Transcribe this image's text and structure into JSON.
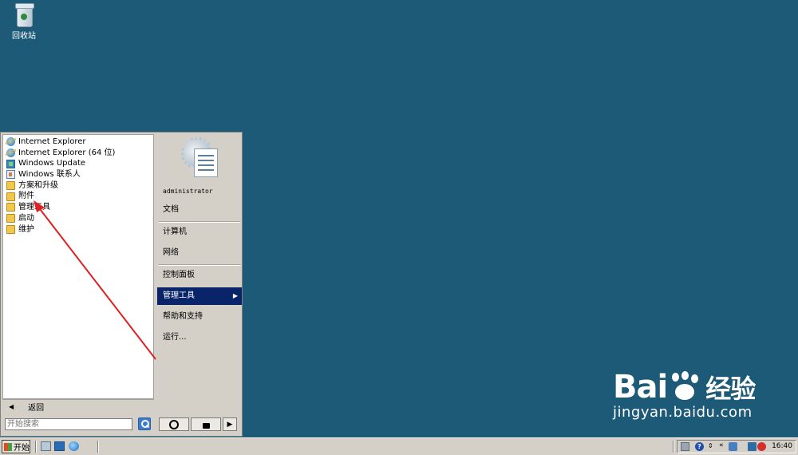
{
  "desktop": {
    "recycle_bin_label": "回收站"
  },
  "start_menu": {
    "programs": [
      {
        "label": "Internet Explorer",
        "icon": "ie-icon"
      },
      {
        "label": "Internet Explorer (64 位)",
        "icon": "ie-icon"
      },
      {
        "label": "Windows Update",
        "icon": "windows-update-icon"
      },
      {
        "label": "Windows 联系人",
        "icon": "contacts-icon"
      },
      {
        "label": "方案和升级",
        "icon": "folder-icon"
      },
      {
        "label": "附件",
        "icon": "folder-icon"
      },
      {
        "label": "管理工具",
        "icon": "folder-icon"
      },
      {
        "label": "启动",
        "icon": "folder-icon"
      },
      {
        "label": "维护",
        "icon": "folder-icon"
      }
    ],
    "back_label": "返回",
    "search_placeholder": "开始搜索",
    "user_name": "administrator",
    "right_items": [
      {
        "label": "文档"
      },
      {
        "label": "计算机"
      },
      {
        "label": "网络"
      },
      {
        "label": "控制面板"
      },
      {
        "label": "管理工具",
        "active": true
      },
      {
        "label": "帮助和支持"
      },
      {
        "label": "运行..."
      }
    ],
    "power_icons": [
      "power-icon",
      "lock-icon",
      "arrow-right-icon"
    ]
  },
  "taskbar": {
    "start_label": "开始",
    "clock": "16:40",
    "tray_chevron": "«"
  },
  "watermark": {
    "brand_left": "Bai",
    "brand_right": "经验",
    "url": "jingyan.baidu.com"
  },
  "colors": {
    "desktop": "#1c5a78",
    "highlight": "#0a246a",
    "annotation_arrow": "#e02020"
  }
}
